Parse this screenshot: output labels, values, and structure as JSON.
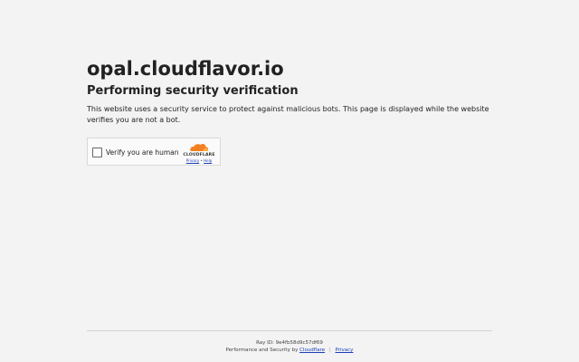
{
  "site": {
    "domain": "opal.cloudflavor.io"
  },
  "main": {
    "heading": "Performing security verification",
    "description": "This website uses a security service to protect against malicious bots. This page is displayed while the website verifies you are not a bot."
  },
  "widget": {
    "checkbox_label": "Verify you are human",
    "brand_name": "CLOUDFLARE",
    "privacy_link": "Privacy",
    "link_separator": "•",
    "help_link": "Help",
    "logo_color": "#f38020"
  },
  "footer": {
    "ray_id": "Ray ID: 9e4fb58d9c57df69",
    "performance_text": "Performance and Security by",
    "cloudflare_link": "Cloudflare",
    "separator": "|",
    "privacy_link": "Privacy"
  }
}
